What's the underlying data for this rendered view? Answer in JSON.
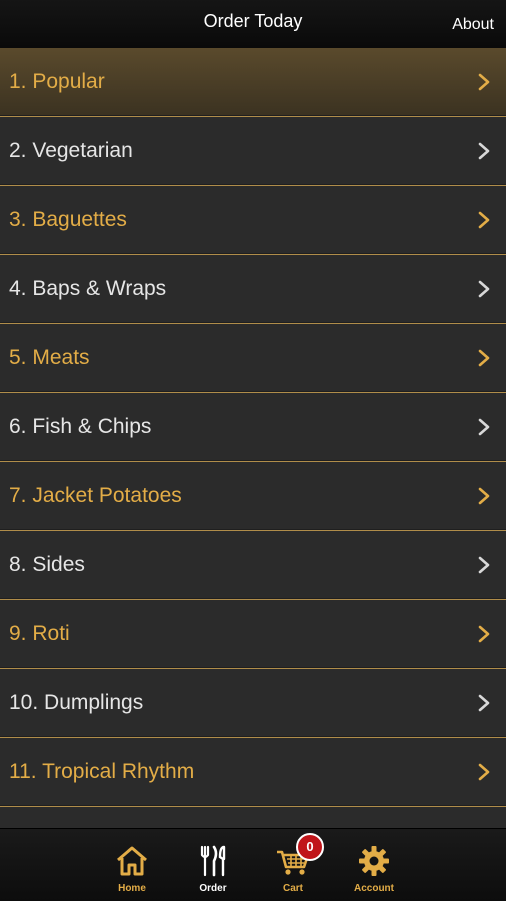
{
  "header": {
    "title": "Order Today",
    "about_label": "About"
  },
  "menu": {
    "items": [
      {
        "label": "1. Popular",
        "color": "gold",
        "selected": true
      },
      {
        "label": "2. Vegetarian",
        "color": "white"
      },
      {
        "label": "3. Baguettes",
        "color": "gold"
      },
      {
        "label": "4. Baps & Wraps",
        "color": "white"
      },
      {
        "label": "5. Meats",
        "color": "gold"
      },
      {
        "label": "6. Fish & Chips",
        "color": "white"
      },
      {
        "label": "7. Jacket Potatoes",
        "color": "gold"
      },
      {
        "label": "8. Sides",
        "color": "white"
      },
      {
        "label": "9. Roti",
        "color": "gold"
      },
      {
        "label": "10. Dumplings",
        "color": "white"
      },
      {
        "label": "11. Tropical Rhythm",
        "color": "gold"
      }
    ]
  },
  "tabbar": {
    "home_label": "Home",
    "order_label": "Order",
    "cart_label": "Cart",
    "cart_count": "0",
    "account_label": "Account"
  },
  "colors": {
    "gold": "#e3ad47",
    "white": "#e6e6e6",
    "badge": "#c0151a"
  }
}
